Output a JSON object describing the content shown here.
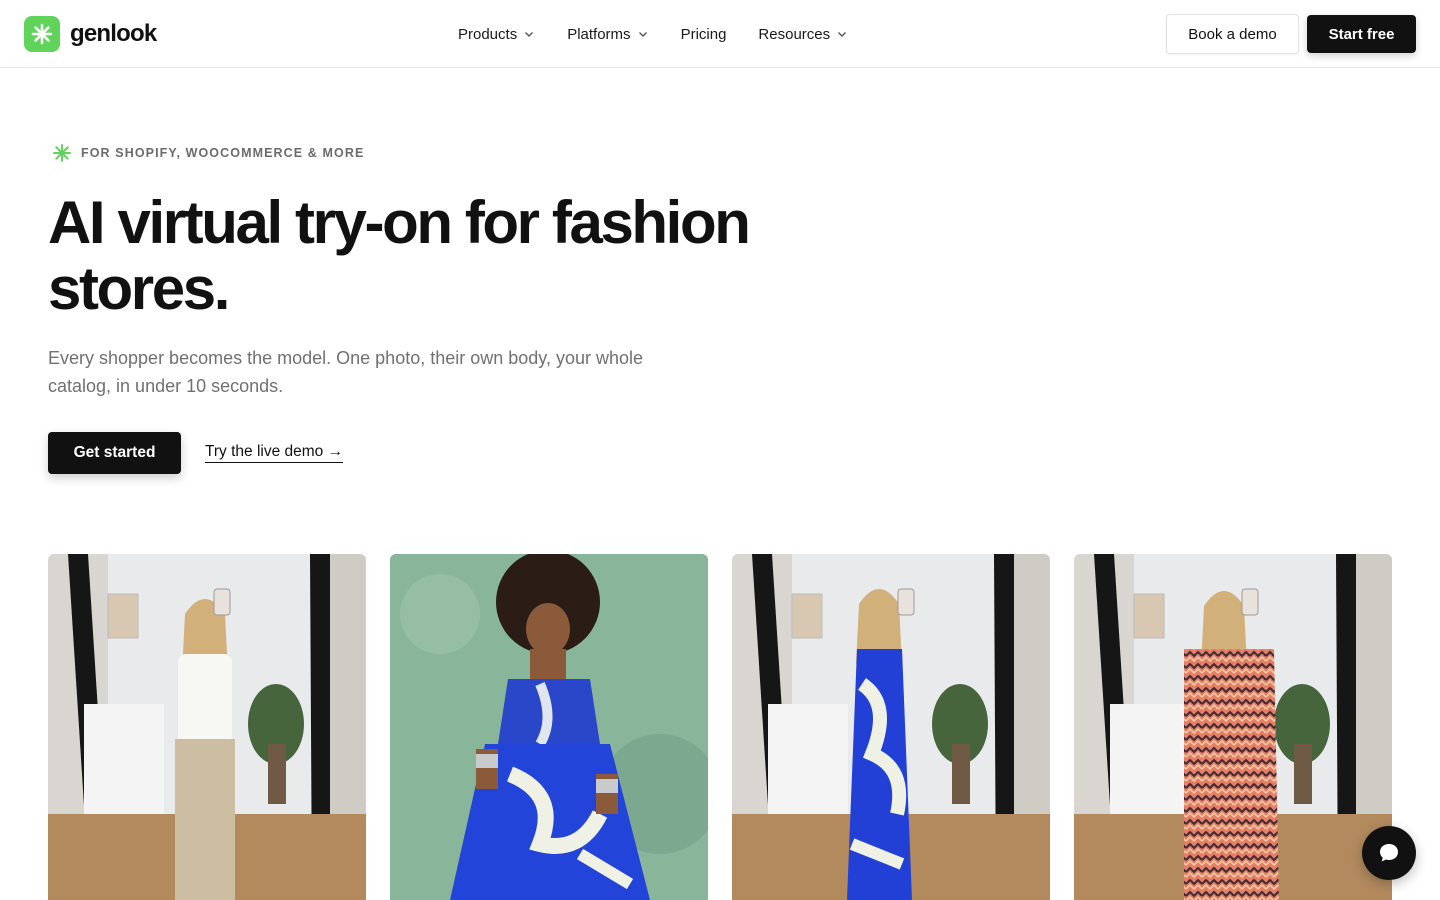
{
  "brand": {
    "name": "genlook",
    "accent": "#5fd35a"
  },
  "nav": {
    "items": [
      {
        "label": "Products",
        "has_dropdown": true
      },
      {
        "label": "Platforms",
        "has_dropdown": true
      },
      {
        "label": "Pricing",
        "has_dropdown": false
      },
      {
        "label": "Resources",
        "has_dropdown": true
      }
    ],
    "book_demo_label": "Book a demo",
    "start_free_label": "Start free"
  },
  "hero": {
    "eyebrow": "FOR SHOPIFY, WOOCOMMERCE & MORE",
    "title": "AI virtual try-on for fashion stores.",
    "subtitle": "Every shopper becomes the model. One photo, their own body, your whole catalog, in under 10 seconds.",
    "primary_cta": "Get started",
    "secondary_cta": "Try the live demo →"
  },
  "gallery": [
    {
      "outfit": "white long-sleeve top, beige wide-leg trousers"
    },
    {
      "outfit": "blue and white printed slip dress"
    },
    {
      "outfit": "blue and white printed slip dress"
    },
    {
      "outfit": "pink and orange zigzag maxi dress"
    }
  ],
  "icons": [
    "sparkle-icon",
    "chevron-down-icon",
    "chat-bubble-icon"
  ]
}
